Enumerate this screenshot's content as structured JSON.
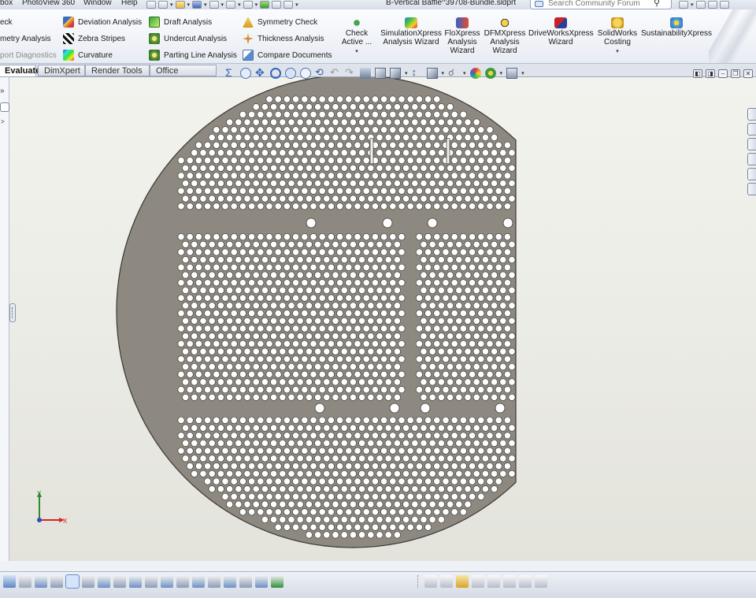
{
  "menubar": {
    "items": [
      "box",
      "PhotoView 360",
      "Window",
      "Help"
    ],
    "document_title": "B-Vertical Baffle^39708-Bundle.sldprt"
  },
  "search": {
    "placeholder": "Search Community Forum"
  },
  "ribbon": {
    "col1": [
      "eck",
      "metry Analysis",
      "port Diagnostics"
    ],
    "col2": [
      "Deviation Analysis",
      "Zebra Stripes",
      "Curvature"
    ],
    "col3": [
      "Draft Analysis",
      "Undercut Analysis",
      "Parting Line Analysis"
    ],
    "col4": [
      "Symmetry Check",
      "Thickness Analysis",
      "Compare Documents"
    ],
    "big": {
      "check_active": [
        "Check",
        "Active ..."
      ],
      "simulation": [
        "SimulationXpress",
        "Analysis Wizard"
      ],
      "floxpress": [
        "FloXpress",
        "Analysis",
        "Wizard"
      ],
      "dfmxpress": [
        "DFMXpress",
        "Analysis",
        "Wizard"
      ],
      "driveworks": [
        "DriveWorksXpress",
        "Wizard"
      ],
      "costing": [
        "SolidWorks",
        "Costing"
      ],
      "sustainability": [
        "SustainabilityXpress"
      ]
    }
  },
  "tabs": [
    "Evaluate",
    "DimXpert",
    "Render Tools",
    "Office Products"
  ],
  "active_tab": "Evaluate",
  "triad": {
    "y": "Y",
    "x": "X"
  },
  "colors": {
    "part_fill": "#8d8980",
    "part_edge": "#3a3835",
    "hole": "#ffffff",
    "viewport": "#efefea"
  }
}
